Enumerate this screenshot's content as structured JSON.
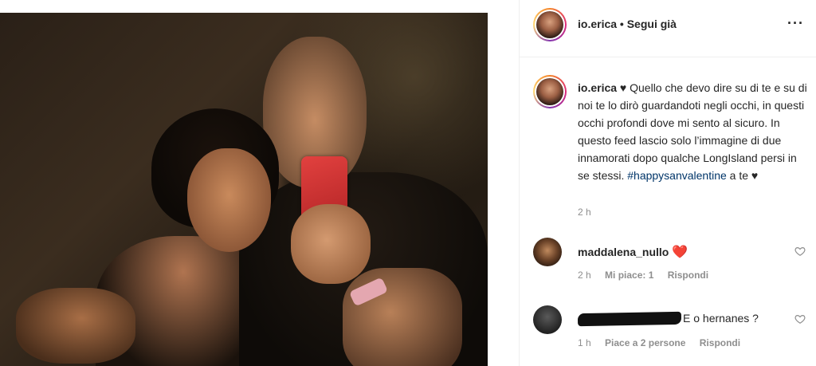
{
  "post": {
    "photo_alt": "",
    "author": {
      "username": "io.erica",
      "follow_status": "Segui già",
      "separator": "•"
    },
    "more_icon": "more-options-icon",
    "caption": {
      "username": "io.erica",
      "text_part1": " ♥ Quello che devo dire su di te e su di noi te lo dirò guardandoti negli occhi, in questi occhi profondi dove mi sento al sicuro. In questo feed lascio solo l’immagine di due innamorati dopo qualche LongIsland persi in se stessi. ",
      "hashtag": "#happysanvalentine",
      "text_part2": " a te ♥",
      "time": "2 h"
    }
  },
  "comments": [
    {
      "username": "maddalena_nullo",
      "text": "",
      "emoji": "❤️",
      "time": "2 h",
      "likes": "Mi piace: 1",
      "reply": "Rispondi"
    },
    {
      "username": "",
      "text": "E o hernanes ?",
      "redacted": true,
      "time": "1 h",
      "likes": "Piace a 2 persone",
      "reply": "Rispondi"
    }
  ],
  "colors": {
    "text": "#262626",
    "meta": "#8e8e8e",
    "hashtag": "#003569",
    "heart": "#ed4956",
    "border": "#efefef"
  }
}
